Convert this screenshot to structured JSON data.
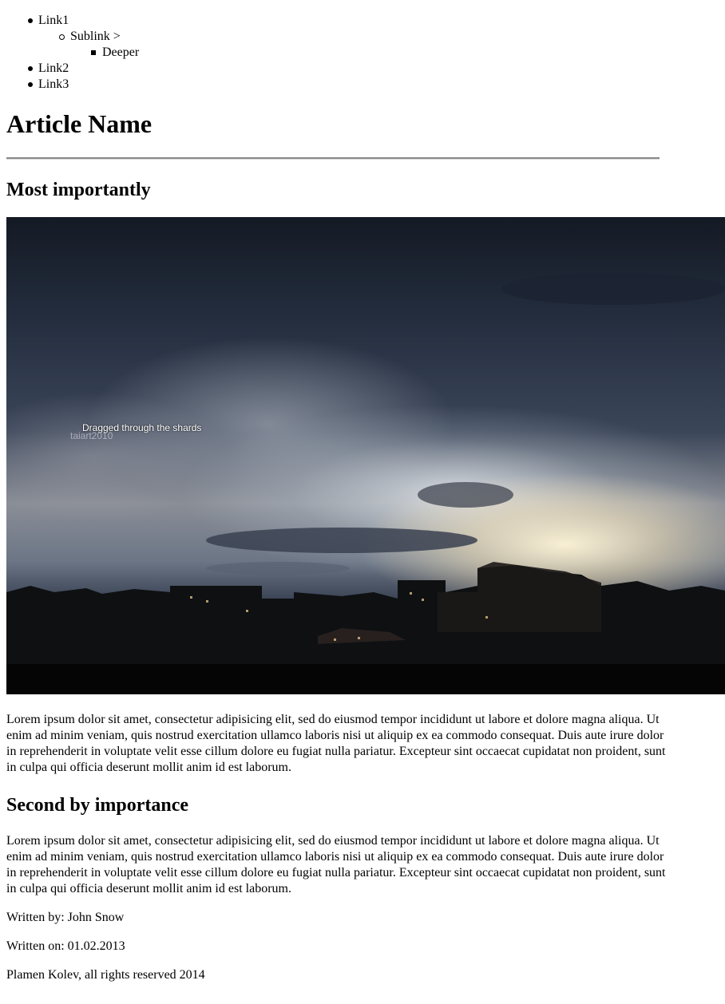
{
  "nav": {
    "items": [
      {
        "label": "Link1",
        "children": [
          {
            "label": "Sublink >",
            "children": [
              {
                "label": "Deeper"
              }
            ]
          }
        ]
      },
      {
        "label": "Link2"
      },
      {
        "label": "Link3"
      }
    ]
  },
  "article": {
    "title": "Article Name",
    "sections": [
      {
        "heading": "Most importantly"
      },
      {
        "heading": "Second by importance"
      }
    ],
    "image": {
      "caption": "Dragged through the shards",
      "credit": "taiart2010"
    },
    "paragraph": "Lorem ipsum dolor sit amet, consectetur adipisicing elit, sed do eiusmod tempor incididunt ut labore et dolore magna aliqua. Ut enim ad minim veniam, quis nostrud exercitation ullamco laboris nisi ut aliquip ex ea commodo consequat. Duis aute irure dolor in reprehenderit in voluptate velit esse cillum dolore eu fugiat nulla pariatur. Excepteur sint occaecat cupidatat non proident, sunt in culpa qui officia deserunt mollit anim id est laborum.",
    "author": "Written by: John Snow",
    "date": "Written on: 01.02.2013"
  },
  "footer": {
    "text": "Plamen Kolev, all rights reserved 2014"
  },
  "colors": {
    "text": "#000000",
    "background": "#ffffff",
    "divider": "#8a8a8a"
  }
}
